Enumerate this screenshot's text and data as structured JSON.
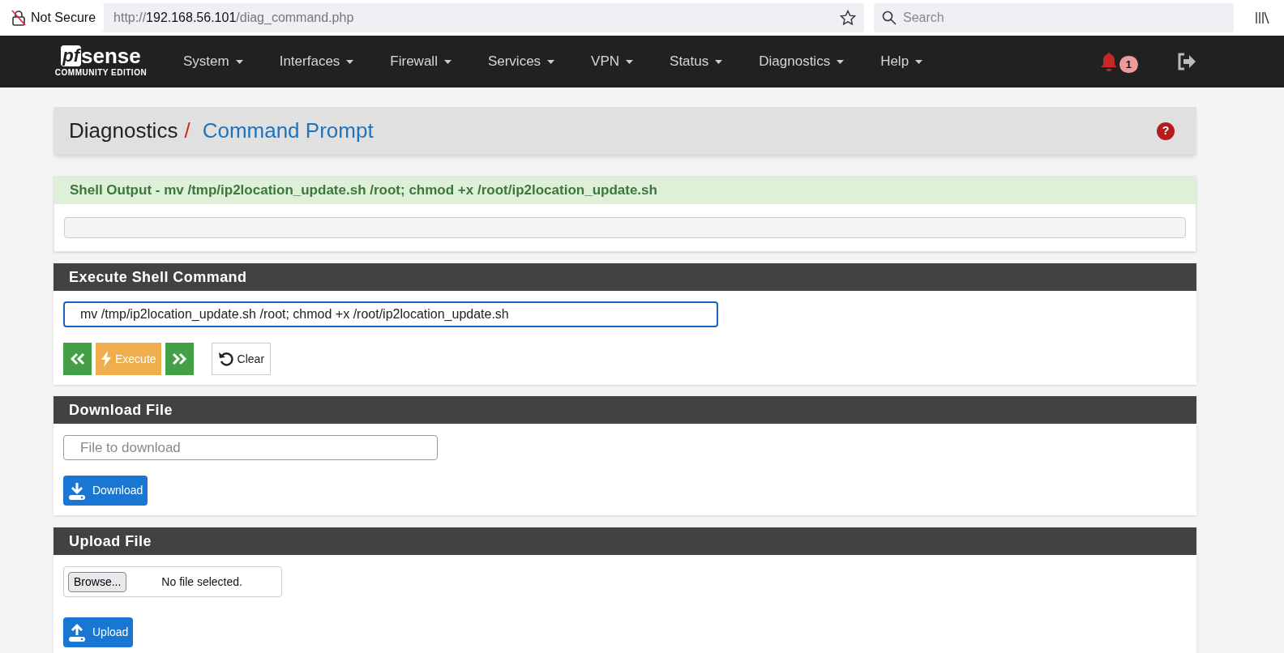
{
  "browser": {
    "security_label": "Not Secure",
    "url_prefix": "http://",
    "url_host": "192.168.56.101",
    "url_path": "/diag_command.php",
    "search_placeholder": "Search"
  },
  "logo": {
    "mark": "pf",
    "name": "sense",
    "edition": "COMMUNITY EDITION"
  },
  "nav": {
    "items": [
      "System",
      "Interfaces",
      "Firewall",
      "Services",
      "VPN",
      "Status",
      "Diagnostics",
      "Help"
    ],
    "notification_count": "1"
  },
  "breadcrumb": {
    "section": "Diagnostics",
    "separator": "/",
    "page": "Command Prompt",
    "help": "?"
  },
  "output_panel": {
    "title": "Shell Output - mv /tmp/ip2location_update.sh /root; chmod +x /root/ip2location_update.sh"
  },
  "execute_panel": {
    "title": "Execute Shell Command",
    "command": "mv /tmp/ip2location_update.sh /root; chmod +x /root/ip2location_update.sh",
    "buttons": [
      {
        "kind": "prev"
      },
      {
        "kind": "execute",
        "label": "Execute"
      },
      {
        "kind": "next"
      },
      {
        "kind": "clear",
        "label": "Clear"
      }
    ]
  },
  "download_panel": {
    "title": "Download File",
    "placeholder": "File to download",
    "button": "Download"
  },
  "upload_panel": {
    "title": "Upload File",
    "browse": "Browse...",
    "file_status": "No file selected.",
    "button": "Upload"
  }
}
